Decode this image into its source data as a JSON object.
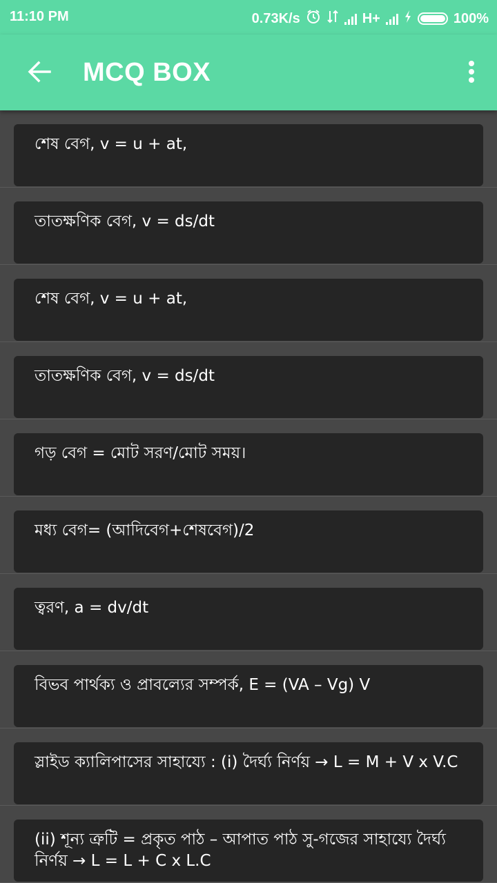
{
  "status_bar": {
    "time": "11:10 PM",
    "speed": "0.73K/s",
    "network": "H+",
    "battery": "100%"
  },
  "app_bar": {
    "title": "MCQ BOX"
  },
  "items": [
    {
      "text": "শেষ বেগ, v = u + at,"
    },
    {
      "text": "তাতক্ষণিক বেগ, v = ds/dt"
    },
    {
      "text": "শেষ বেগ, v = u + at,"
    },
    {
      "text": "তাতক্ষণিক বেগ, v = ds/dt"
    },
    {
      "text": "গড় বেগ = মোট সরণ/মোট সময়।"
    },
    {
      "text": "মধ্য বেগ= (আদিবেগ+শেষবেগ)/2"
    },
    {
      "text": "ত্বরণ, a = dv/dt"
    },
    {
      "text": "বিভব পার্থক্য ও প্রাবল্যের সম্পর্ক, E = (VA – Vg) V"
    },
    {
      "text": "স্লাইড ক্যালিপাসের সাহায্যে : (i) দৈর্ঘ্য নির্ণয় → L = M + V x V.C"
    },
    {
      "text": "(ii) শূন্য ত্রুটি = প্রকৃত পাঠ – আপাত পাঠ সু-গজের সাহায্যে দৈর্ঘ্য নির্ণয় → L = L + C x L.C"
    }
  ]
}
